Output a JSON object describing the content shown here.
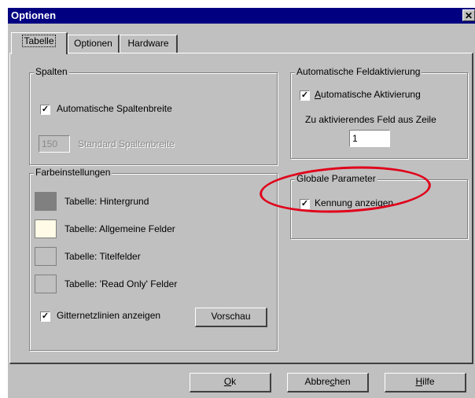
{
  "window": {
    "title": "Optionen",
    "close_symbol": "✕"
  },
  "tabs": [
    "Tabelle",
    "Optionen",
    "Hardware"
  ],
  "spalten": {
    "legend": "Spalten",
    "auto_width_label": "Automatische Spaltenbreite",
    "auto_width_checked": true,
    "width_value": "150",
    "width_label": "Standard Spaltenbreite"
  },
  "farb": {
    "legend": "Farbeinstellungen",
    "items": [
      {
        "label": "Tabelle: Hintergrund",
        "color": "#808080"
      },
      {
        "label": "Tabelle: Allgemeine Felder",
        "color": "#fffbe6"
      },
      {
        "label": "Tabelle: Titelfelder",
        "color": "#c0c0c0"
      },
      {
        "label": "Tabelle: 'Read Only' Felder",
        "color": "#c0c0c0"
      }
    ],
    "grid_label": "Gitternetzlinien anzeigen",
    "grid_checked": true,
    "preview_button": "Vorschau"
  },
  "auto_feld": {
    "legend": "Automatische Feldaktivierung",
    "auto_label_underlined": "A",
    "auto_label_rest": "utomatische Aktivierung",
    "auto_checked": true,
    "row_label": "Zu aktivierendes Feld aus Zeile",
    "row_value": "1"
  },
  "global": {
    "legend": "Globale Parameter",
    "id_label": "Kennung anzeigen",
    "id_checked": true
  },
  "buttons": {
    "ok_underlined": "O",
    "ok_rest": "k",
    "cancel_a": "Abbre",
    "cancel_underlined": "c",
    "cancel_b": "hen",
    "help_underlined": "H",
    "help_rest": "ilfe"
  },
  "check_mark": "✓",
  "colors": {
    "titlebar": "#000080",
    "face": "#c0c0c0",
    "highlight": "#e0001a"
  }
}
